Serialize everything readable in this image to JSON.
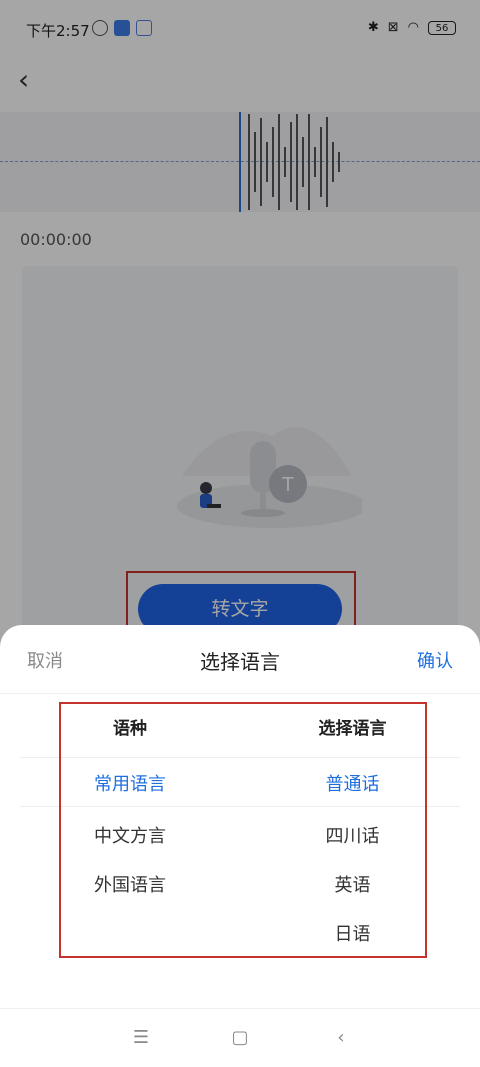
{
  "status_bar": {
    "time": "下午2:57",
    "battery": "56"
  },
  "recording": {
    "elapsed": "00:00:00",
    "convert_button_label": "转文字"
  },
  "sheet": {
    "cancel_label": "取消",
    "title": "选择语言",
    "confirm_label": "确认",
    "left_column": {
      "header": "语种",
      "options": [
        "常用语言",
        "中文方言",
        "外国语言"
      ],
      "selected_index": 0
    },
    "right_column": {
      "header": "选择语言",
      "options": [
        "普通话",
        "四川话",
        "英语",
        "日语"
      ],
      "selected_index": 0
    }
  },
  "nav_bar": {
    "icons": [
      "menu-icon",
      "home-icon",
      "back-icon"
    ]
  },
  "colors": {
    "accent": "#1f6fe0",
    "button": "#1f63e6",
    "annotation": "#c6332a"
  }
}
